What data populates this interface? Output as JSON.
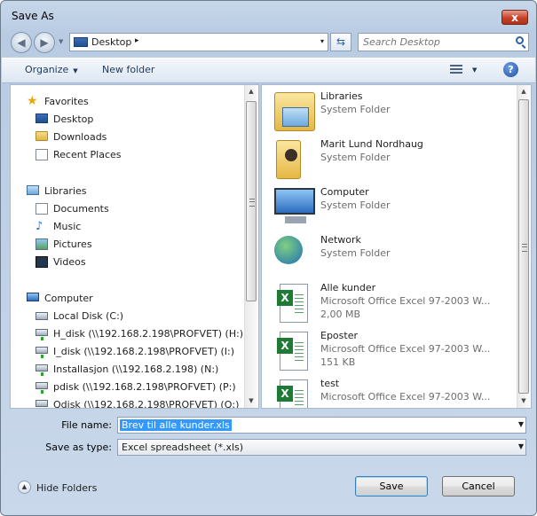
{
  "window": {
    "title": "Save As",
    "close_label": "x"
  },
  "address": {
    "location": "Desktop",
    "separator": "▸",
    "dropdown": "▾"
  },
  "search": {
    "placeholder": "Search Desktop"
  },
  "toolbar": {
    "organize_label": "Organize",
    "new_folder_label": "New folder",
    "help_label": "?"
  },
  "navigation": {
    "favorites": {
      "label": "Favorites",
      "items": [
        "Desktop",
        "Downloads",
        "Recent Places"
      ]
    },
    "libraries": {
      "label": "Libraries",
      "items": [
        "Documents",
        "Music",
        "Pictures",
        "Videos"
      ]
    },
    "computer": {
      "label": "Computer",
      "items": [
        "Local Disk (C:)",
        "H_disk (\\\\192.168.2.198\\PROFVET) (H:)",
        "I_disk (\\\\192.168.2.198\\PROFVET) (I:)",
        "Installasjon (\\\\192.168.2.198) (N:)",
        "pdisk (\\\\192.168.2.198\\PROFVET) (P:)",
        "Qdisk (\\\\192.168.2.198\\PROFVET) (Q:)"
      ]
    }
  },
  "files": [
    {
      "name": "Libraries",
      "type": "System Folder",
      "size": "",
      "icon": "libraries-icon"
    },
    {
      "name": "Marit Lund Nordhaug",
      "type": "System Folder",
      "size": "",
      "icon": "user-folder-icon"
    },
    {
      "name": "Computer",
      "type": "System Folder",
      "size": "",
      "icon": "computer-icon"
    },
    {
      "name": "Network",
      "type": "System Folder",
      "size": "",
      "icon": "network-icon"
    },
    {
      "name": "Alle kunder",
      "type": "Microsoft Office Excel 97-2003 W...",
      "size": "2,00 MB",
      "icon": "excel-file-icon"
    },
    {
      "name": "Eposter",
      "type": "Microsoft Office Excel 97-2003 W...",
      "size": "151 KB",
      "icon": "excel-file-icon"
    },
    {
      "name": "test",
      "type": "Microsoft Office Excel 97-2003 W...",
      "size": "",
      "icon": "excel-file-icon"
    }
  ],
  "form": {
    "filename_label": "File name:",
    "filename_value": "Brev til alle kunder.xls",
    "savetype_label": "Save as type:",
    "savetype_value": "Excel spreadsheet (*.xls)"
  },
  "footer": {
    "hide_folders_label": "Hide Folders",
    "save_label": "Save",
    "cancel_label": "Cancel"
  },
  "colors": {
    "accent": "#3399ff",
    "close": "#c7412a",
    "chrome": "#c7d7ea"
  }
}
